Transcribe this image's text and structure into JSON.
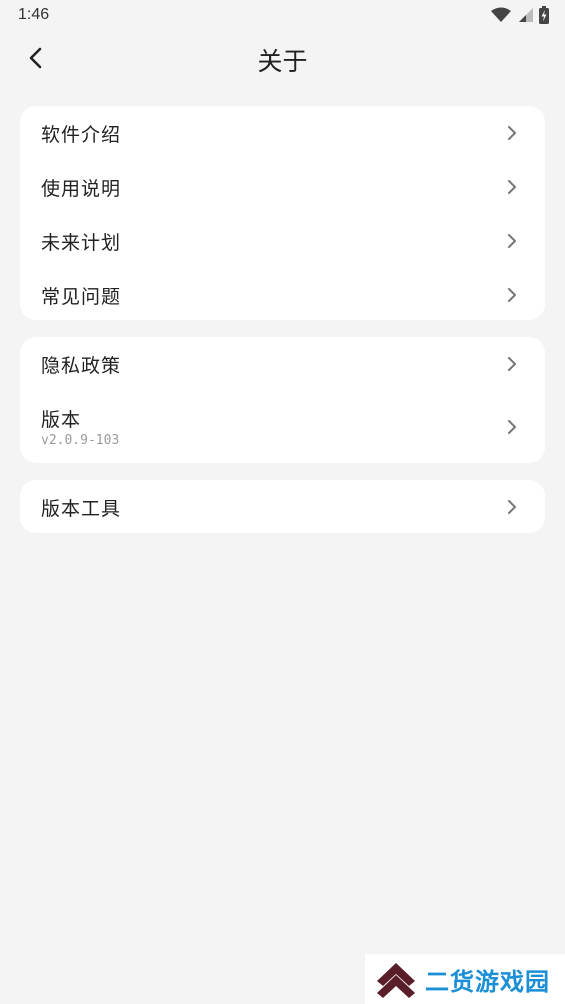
{
  "status_bar": {
    "time": "1:46"
  },
  "header": {
    "title": "关于"
  },
  "groups": [
    {
      "items": [
        {
          "label": "软件介绍"
        },
        {
          "label": "使用说明"
        },
        {
          "label": "未来计划"
        },
        {
          "label": "常见问题"
        }
      ]
    },
    {
      "items": [
        {
          "label": "隐私政策"
        },
        {
          "label": "版本",
          "sub": "v2.0.9-103"
        }
      ]
    },
    {
      "items": [
        {
          "label": "版本工具"
        }
      ]
    }
  ],
  "watermark": {
    "text": "二货游戏园"
  },
  "colors": {
    "background": "#f4f4f4",
    "card": "#ffffff",
    "text": "#222222",
    "secondary_text": "#9a9a9a",
    "chevron": "#777777",
    "watermark_text": "#1a8fd6"
  },
  "icons": {
    "back": "chevron-left-icon",
    "row_arrow": "chevron-right-icon",
    "wifi": "wifi-icon",
    "signal": "signal-icon",
    "battery": "battery-icon"
  }
}
